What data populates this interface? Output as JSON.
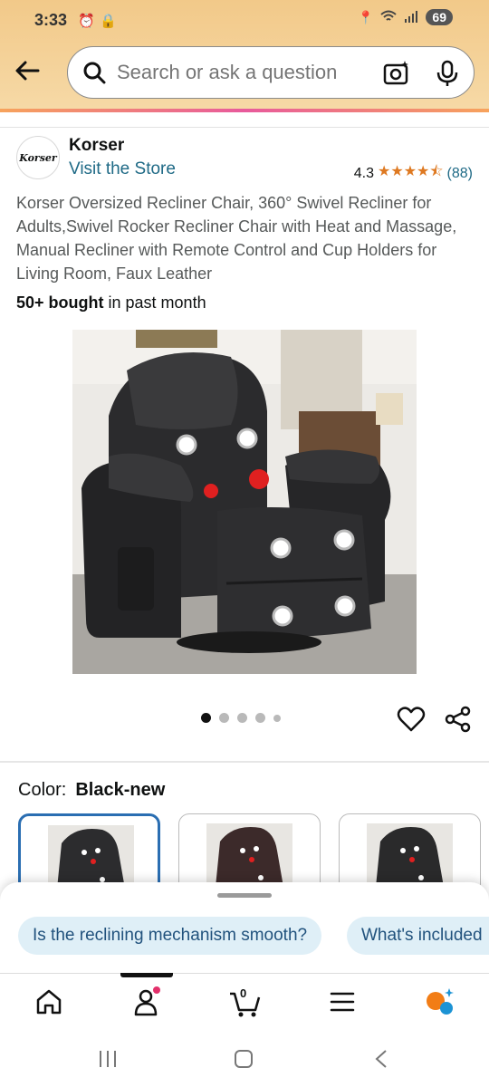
{
  "status_bar": {
    "time": "3:33",
    "battery": "69"
  },
  "search": {
    "placeholder": "Search or ask a question"
  },
  "brand": {
    "logo_text": "Korser",
    "name": "Korser",
    "visit_store": "Visit the Store"
  },
  "rating": {
    "value": "4.3",
    "stars": "★★★★⯪",
    "count": "(88)"
  },
  "product": {
    "title": "Korser Oversized Recliner Chair, 360° Swivel Recliner for Adults,Swivel Rocker Recliner Chair with Heat and Massage, Manual Recliner with Remote Control and Cup Holders for Living Room, Faux Leather",
    "bought_strong": "50+ bought",
    "bought_rest": " in past month"
  },
  "gallery": {
    "image_count": 5,
    "active_index": 0
  },
  "color": {
    "label": "Color:",
    "value": "Black-new"
  },
  "suggestions": [
    "Is the reclining mechanism smooth?",
    "What's included"
  ],
  "bottom_nav": {
    "items": [
      "home-icon",
      "account-icon",
      "cart-icon",
      "menu-icon",
      "rufus-icon"
    ],
    "cart_count": "0",
    "active": "account-icon"
  },
  "colors": {
    "accent_link": "#1f6a86",
    "star": "#de7921",
    "chip_bg": "#dfeff7",
    "header_bg": "#f2c989",
    "selected_border": "#2a6eb2"
  }
}
